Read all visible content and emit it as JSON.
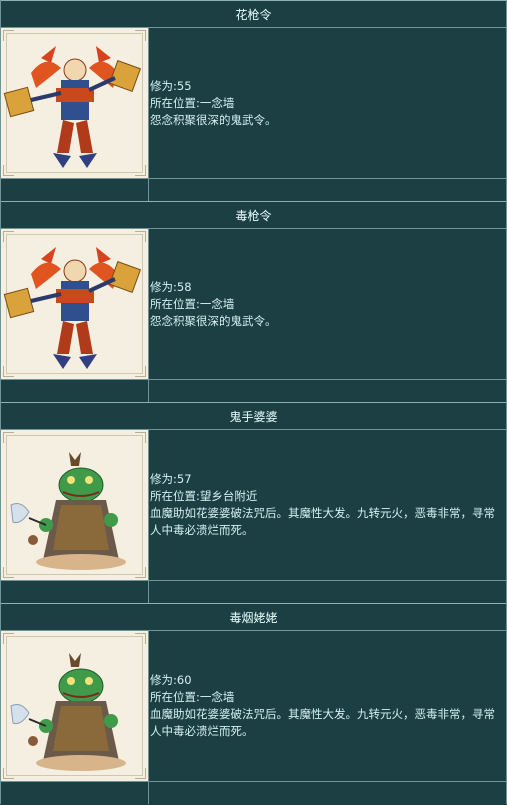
{
  "entries": [
    {
      "name": "花枪令",
      "level": "修为:55",
      "location": "所在位置:一念墙",
      "desc": "怨念积聚很深的鬼武令。",
      "portrait": "ghost-warrior-portrait"
    },
    {
      "name": "毒枪令",
      "level": "修为:58",
      "location": "所在位置:一念墙",
      "desc": "怨念积聚很深的鬼武令。",
      "portrait": "ghost-warrior-portrait"
    },
    {
      "name": "鬼手婆婆",
      "level": "修为:57",
      "location": "所在位置:望乡台附近",
      "desc": "血魔助如花婆婆破法咒后。其魔性大发。九转元火，恶毒非常，寻常人中毒必溃烂而死。",
      "portrait": "toad-demon-portrait"
    },
    {
      "name": "毒烟姥姥",
      "level": "修为:60",
      "location": "所在位置:一念墙",
      "desc": "血魔助如花婆婆破法咒后。其魔性大发。九转元火，恶毒非常，寻常人中毒必溃烂而死。",
      "portrait": "toad-demon-portrait"
    }
  ]
}
